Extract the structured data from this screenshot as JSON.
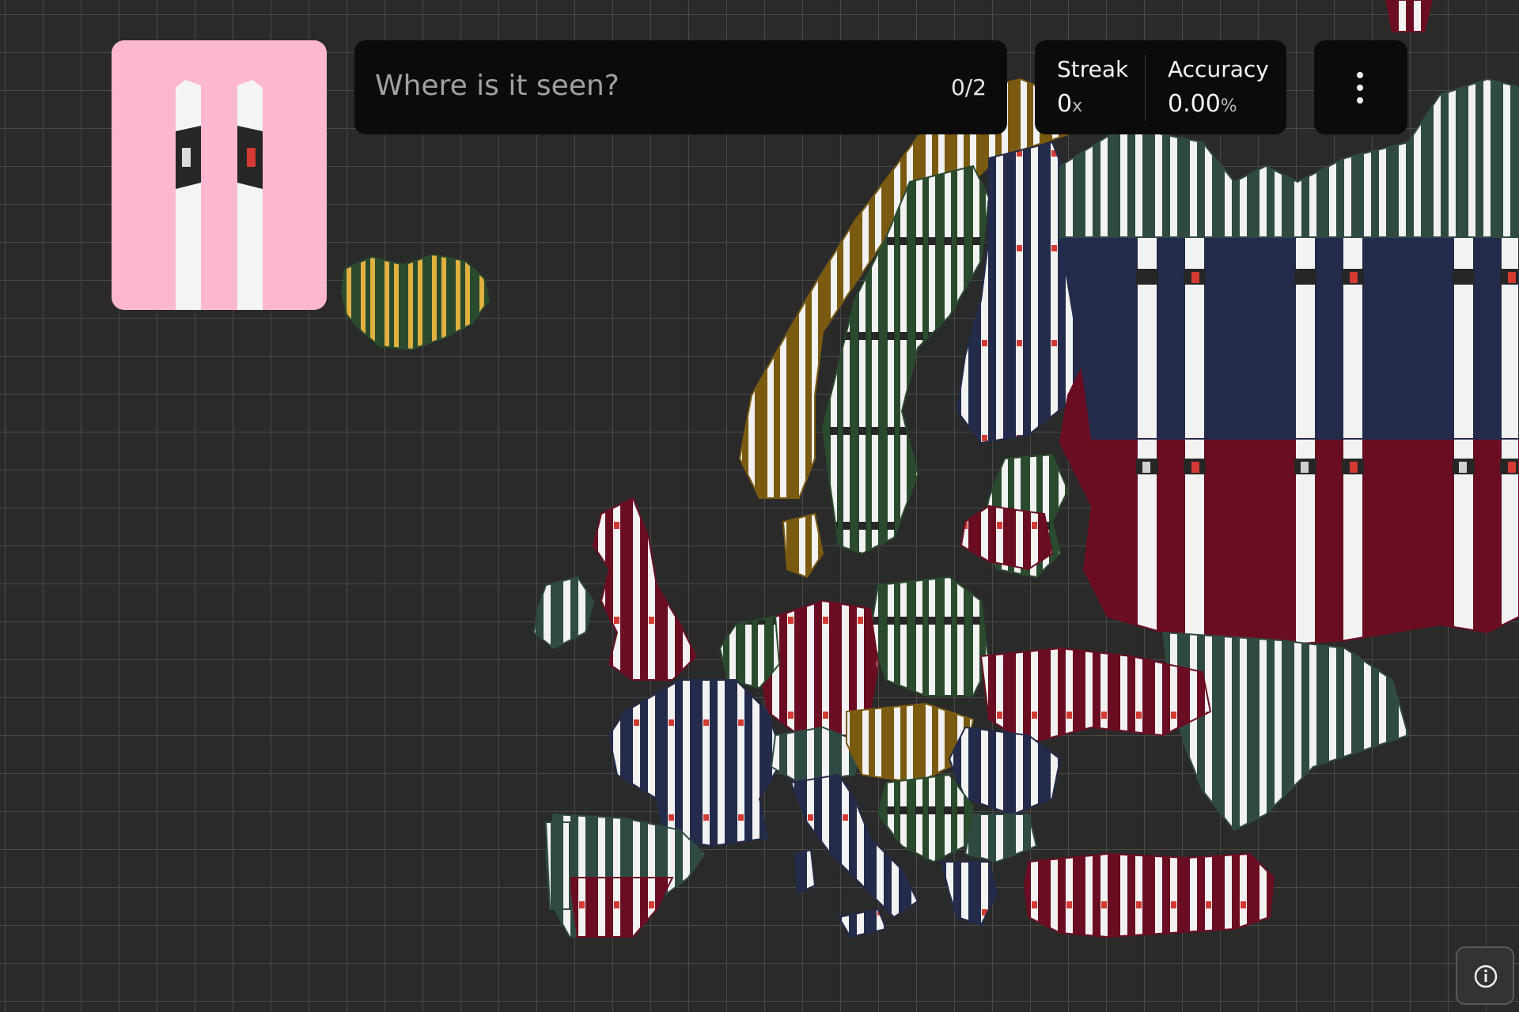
{
  "prompt": {
    "question": "Where is it seen?",
    "progress": "0/2"
  },
  "stats": {
    "streak_label": "Streak",
    "streak_value": "0",
    "streak_unit": "x",
    "accuracy_label": "Accuracy",
    "accuracy_value": "0.00",
    "accuracy_unit": "%"
  },
  "icons": {
    "card": "bollard-icon",
    "menu": "more-vertical-icon",
    "info": "info-icon"
  },
  "colors": {
    "card_background": "#fdb8d0",
    "bollard_white": "#f4f4f4",
    "bollard_band": "#262626",
    "left_reflector": "#dcdcdc",
    "right_reflector": "#d23a32",
    "region_green": "#2a4a2e",
    "region_teal": "#2f4a42",
    "region_navy": "#242a4a",
    "region_maroon": "#6a0d22",
    "region_ochre": "#7a5a10",
    "region_amber": "#a07a14"
  }
}
